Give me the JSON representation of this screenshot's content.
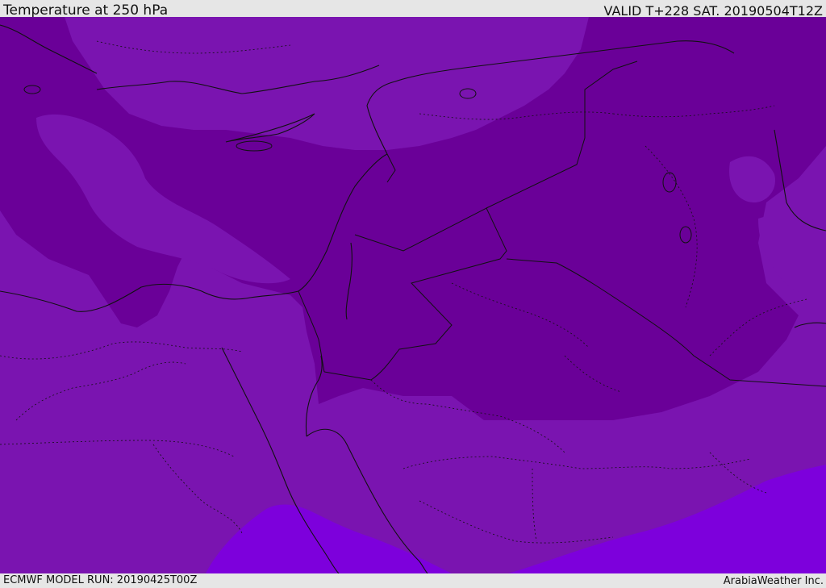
{
  "header": {
    "title": "Temperature at 250 hPa",
    "valid_time": "VALID T+228 SAT. 20190504T12Z"
  },
  "footer": {
    "model_run": "ECMWF MODEL RUN: 20190425T00Z",
    "credit": "ArabiaWeather Inc."
  },
  "map": {
    "field": "temperature",
    "level": "250 hPa",
    "colors": {
      "base": "#7a14b0",
      "cold": "#6a0098",
      "warm": "#7d00dc",
      "coast": "#111111",
      "border": "#111111"
    },
    "icons": [
      "coastline",
      "country-borders",
      "province-borders",
      "temperature-shading"
    ]
  }
}
